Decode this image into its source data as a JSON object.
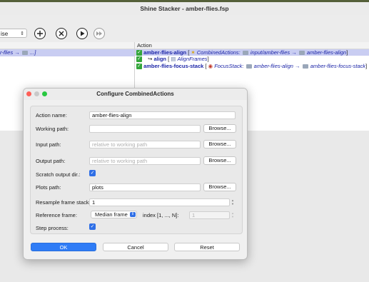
{
  "window": {
    "title": "Shine Stacker - amber-flies.fsp"
  },
  "toolbar": {
    "mode_select": "ise",
    "add_icon": "plus-circle-icon",
    "delete_icon": "x-circle-icon",
    "run_icon": "play-icon",
    "run_all_icon": "fast-forward-icon"
  },
  "left_panel": {
    "selected_text": "r-flies →",
    "selected_suffix": "...]"
  },
  "right_panel": {
    "header": "Action",
    "rows": [
      {
        "name": "amber-flies-align",
        "type_open": " [",
        "type": "CombinedActions:",
        "path": "input/amber-flies →",
        "target": "amber-flies-align",
        "close": "]"
      },
      {
        "arrow": "↪",
        "name": "align",
        "type_open": " [",
        "type": "AlignFrames",
        "close": "]"
      },
      {
        "name": "amber-flies-focus-stack",
        "type_open": " [",
        "type": "FocusStack:",
        "path": "amber-flies-align →",
        "target": "amber-flies-focus-stack",
        "close": "]"
      }
    ]
  },
  "dialog": {
    "title": "Configure CombinedActions",
    "fields": {
      "action_name_label": "Action name:",
      "action_name_value": "amber-flies-align",
      "working_path_label": "Working path:",
      "working_path_value": "",
      "input_path_label": "Input path:",
      "input_path_placeholder": "relative to working path",
      "output_path_label": "Output path:",
      "output_path_placeholder": "relative to working path",
      "scratch_label": "Scratch output dir.:",
      "plots_path_label": "Plots path:",
      "plots_path_value": "plots",
      "resample_label": "Resample frame stack:",
      "resample_value": "1",
      "reference_label": "Reference frame:",
      "reference_value": "Median frame",
      "index_label": "index [1, ..., N]:",
      "index_value": "1",
      "step_label": "Step process:"
    },
    "browse_label": "Browse...",
    "buttons": {
      "ok": "OK",
      "cancel": "Cancel",
      "reset": "Reset"
    },
    "state": {
      "scratch_checked": true,
      "step_checked": true
    }
  }
}
